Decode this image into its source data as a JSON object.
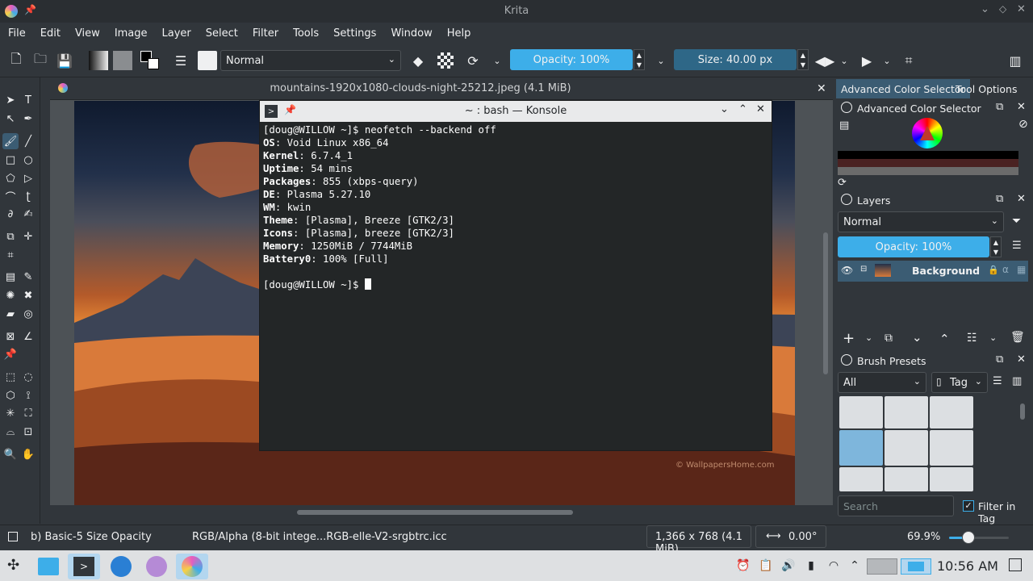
{
  "window": {
    "title": "Krita"
  },
  "menubar": [
    "File",
    "Edit",
    "View",
    "Image",
    "Layer",
    "Select",
    "Filter",
    "Tools",
    "Settings",
    "Window",
    "Help"
  ],
  "toolbar": {
    "blend_mode": "Normal",
    "opacity": "Opacity: 100%",
    "opacity_value": 100,
    "size": "Size: 40.00 px"
  },
  "document": {
    "tab_title": "mountains-1920x1080-clouds-night-25212.jpeg (4.1 MiB)",
    "watermark": "© WallpapersHome.com"
  },
  "konsole": {
    "title": "~ : bash — Konsole",
    "prompt": "[doug@WILLOW ~]$",
    "command": " neofetch --backend off",
    "info": [
      {
        "key": "OS",
        "value": ": Void Linux x86_64"
      },
      {
        "key": "Kernel",
        "value": ": 6.7.4_1"
      },
      {
        "key": "Uptime",
        "value": ": 54 mins"
      },
      {
        "key": "Packages",
        "value": ": 855 (xbps-query)"
      },
      {
        "key": "DE",
        "value": ": Plasma 5.27.10"
      },
      {
        "key": "WM",
        "value": ": kwin"
      },
      {
        "key": "Theme",
        "value": ": [Plasma], Breeze [GTK2/3]"
      },
      {
        "key": "Icons",
        "value": ": [Plasma], breeze [GTK2/3]"
      },
      {
        "key": "Memory",
        "value": ": 1250MiB / 7744MiB"
      },
      {
        "key": "Battery0",
        "value": ": 100% [Full]"
      }
    ],
    "prompt2": "[doug@WILLOW ~]$"
  },
  "dock": {
    "tabs": [
      "Advanced Color Selector",
      "Tool Options"
    ],
    "color_selector_title": "Advanced Color Selector",
    "layers_title": "Layers",
    "layers_blend": "Normal",
    "layers_opacity": "Opacity:  100%",
    "layer_name": "Background",
    "brush_presets_title": "Brush Presets",
    "brush_filter": "All",
    "brush_tag": "Tag",
    "search_placeholder": "Search",
    "filter_in_tag": "Filter in Tag",
    "filter_in_tag_checked": true
  },
  "statusbar": {
    "brush": "b) Basic-5 Size Opacity",
    "color_profile": "RGB/Alpha (8-bit intege...RGB-elle-V2-srgbtrc.icc",
    "image_size": "1,366 x 768 (4.1 MiB)",
    "rotation": "0.00°",
    "zoom": "69.9%",
    "zoom_value": 69.9
  },
  "taskbar": {
    "clock": "10:56 AM"
  },
  "colors": {
    "accent": "#3daee9",
    "bg": "#31363b",
    "term_bg": "#232627"
  }
}
